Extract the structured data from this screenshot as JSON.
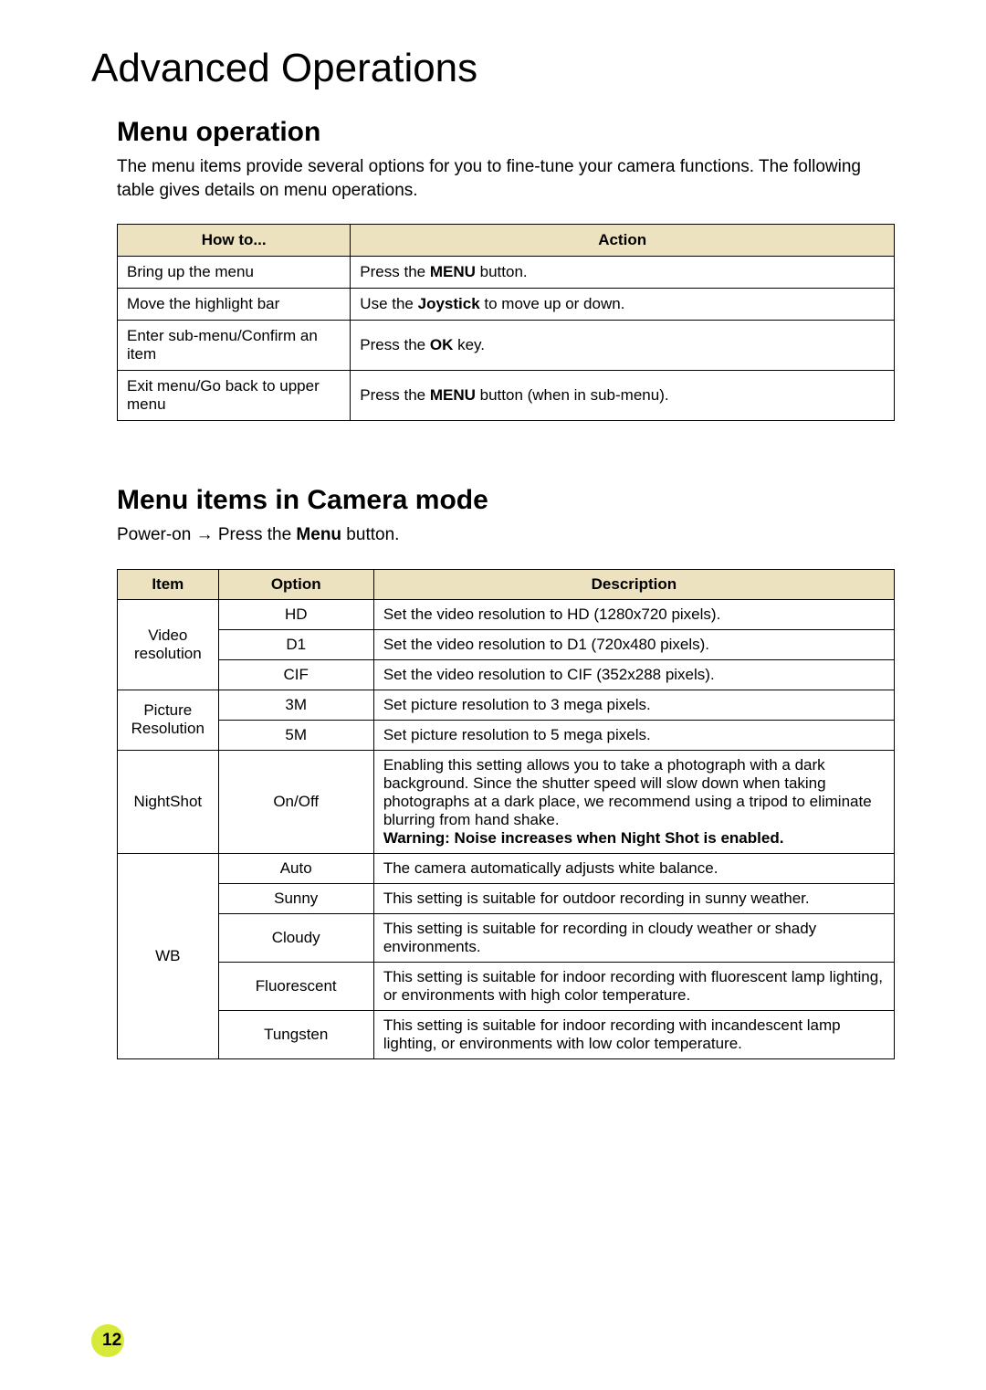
{
  "title": "Advanced Operations",
  "section1": {
    "heading": "Menu operation",
    "intro": "The menu items provide several options for you to fine-tune your camera functions. The following table gives details on menu operations.",
    "headers": {
      "c1": "How to...",
      "c2": "Action"
    },
    "rows": [
      {
        "howto": "Bring up the menu",
        "action_pre": "Press the ",
        "action_bold": "MENU",
        "action_post": " button."
      },
      {
        "howto": "Move the highlight bar",
        "action_pre": "Use the ",
        "action_bold": "Joystick",
        "action_post": " to move up or down."
      },
      {
        "howto": "Enter sub-menu/Confirm an item",
        "action_pre": "Press the ",
        "action_bold": "OK",
        "action_post": " key."
      },
      {
        "howto": "Exit menu/Go back to upper menu",
        "action_pre": "Press the ",
        "action_bold": "MENU",
        "action_post": " button (when in sub-menu)."
      }
    ]
  },
  "section2": {
    "heading": "Menu items in Camera mode",
    "intro_pre": "Power-on → Press the ",
    "intro_bold": "Menu",
    "intro_post": " button.",
    "headers": {
      "c1": "Item",
      "c2": "Option",
      "c3": "Description"
    },
    "items": {
      "video_resolution": "Video resolution",
      "picture_resolution": "Picture Resolution",
      "nightshot": "NightShot",
      "wb": "WB"
    },
    "rows": {
      "vr_hd": {
        "option": "HD",
        "desc": "Set the video resolution to HD (1280x720 pixels)."
      },
      "vr_d1": {
        "option": "D1",
        "desc": "Set the video resolution to D1 (720x480 pixels)."
      },
      "vr_cif": {
        "option": "CIF",
        "desc": "Set the video resolution to CIF (352x288 pixels)."
      },
      "pr_3m": {
        "option": "3M",
        "desc": "Set picture resolution to 3 mega pixels."
      },
      "pr_5m": {
        "option": "5M",
        "desc": "Set picture resolution to 5 mega pixels."
      },
      "ns": {
        "option": "On/Off",
        "desc": "Enabling this setting allows you to take a photograph with a dark background. Since the shutter speed will slow down when taking photographs at a dark place, we recommend using a tripod to eliminate blurring from hand shake.",
        "warn": "Warning: Noise increases when Night Shot is enabled."
      },
      "wb_auto": {
        "option": "Auto",
        "desc": "The camera automatically adjusts white balance."
      },
      "wb_sunny": {
        "option": "Sunny",
        "desc": "This setting is suitable for outdoor recording in sunny weather."
      },
      "wb_cloudy": {
        "option": "Cloudy",
        "desc": "This setting is suitable for recording in cloudy weather or shady environments."
      },
      "wb_fluor": {
        "option": "Fluorescent",
        "desc": "This setting is suitable for indoor recording with fluorescent lamp lighting, or environments with high color temperature."
      },
      "wb_tung": {
        "option": "Tungsten",
        "desc": "This setting is suitable for indoor recording with incandescent lamp lighting, or environments with low color temperature."
      }
    }
  },
  "page_number": "12"
}
